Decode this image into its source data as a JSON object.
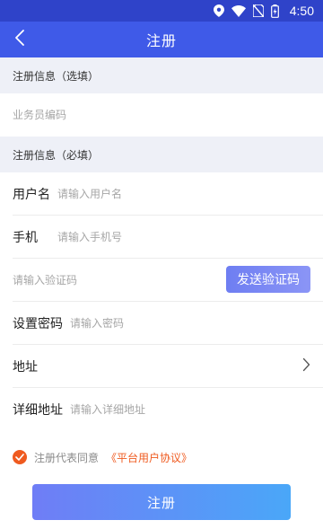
{
  "status_bar": {
    "time": "4:50",
    "icons": [
      "location-icon",
      "wifi-icon",
      "no-sim-icon",
      "battery-icon"
    ]
  },
  "app_bar": {
    "title": "注册",
    "back_icon": "chevron-left-icon"
  },
  "optional_section": {
    "header": "注册信息（选填）",
    "salesperson_code": {
      "value": "",
      "placeholder": "业务员编码"
    }
  },
  "required_section": {
    "header": "注册信息（必填）",
    "username": {
      "label": "用户名",
      "value": "",
      "placeholder": "请输入用户名"
    },
    "phone": {
      "label": "手机",
      "value": "",
      "placeholder": "请输入手机号"
    },
    "verification": {
      "value": "",
      "placeholder": "请输入验证码",
      "send_button": "发送验证码"
    },
    "password": {
      "label": "设置密码",
      "value": "",
      "placeholder": "请输入密码"
    },
    "address": {
      "label": "地址",
      "value": "",
      "chevron_icon": "chevron-right-icon"
    },
    "detail_address": {
      "label": "详细地址",
      "value": "",
      "placeholder": "请输入详细地址"
    }
  },
  "agreement": {
    "checked": true,
    "text": "注册代表同意",
    "link": "《平台用户协议》"
  },
  "submit_button": "注册",
  "colors": {
    "status_bar": "#2f43c9",
    "app_bar": "#3f5ae8",
    "section_bg": "#eef0f7",
    "accent_orange": "#ef5a1f",
    "button_gradient_start": "#6f7df6",
    "button_gradient_end": "#4aa7f8"
  }
}
